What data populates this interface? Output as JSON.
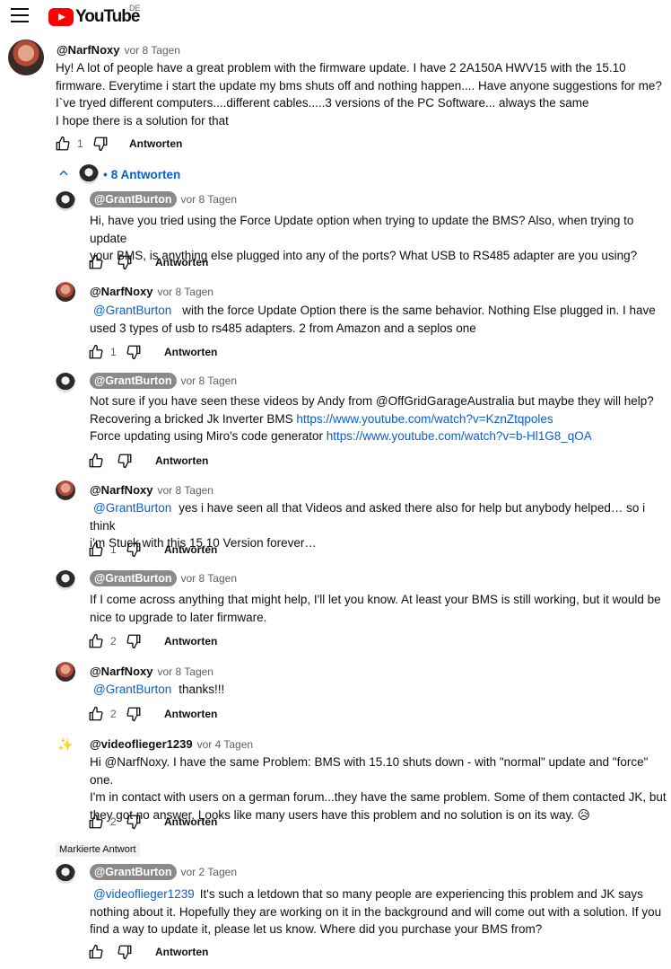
{
  "header": {
    "brand": "YouTube",
    "region": "DE"
  },
  "comment": {
    "author": "@NarfNoxy",
    "time": "vor 8 Tagen",
    "lines": [
      "Hy! A lot of people have a great problem with the firmware update. I have 2 2A150A HWV15 with the 15.10",
      "firmware. Everytime i start the update my bms shuts off and nothing happen.... Have anyone suggestions for me?",
      "I`ve tryed different computers....different cables.....3 versions of the PC Software... always the same",
      "I hope there is a solution for that"
    ],
    "likes": "1",
    "reply_label": "Antworten"
  },
  "replies_toggle": {
    "bullet": "•",
    "label": "8 Antworten"
  },
  "replies": [
    {
      "author": "@GrantBurton",
      "time": "vor 8 Tagen",
      "text1": "Hi, have you tried using the Force Update option when trying to update the BMS? Also, when trying to update",
      "text2": "your BMS, is anything else plugged into any of the ports? What USB to RS485 adapter are you using?",
      "likes": "",
      "reply_label": "Antworten"
    },
    {
      "author": "@NarfNoxy",
      "time": "vor 8 Tagen",
      "mention": "@GrantBurton",
      "text1": "with the force Update Option there is the same behavior. Nothing Else plugged in. I have",
      "text2": "used 3 types of usb to rs485 adapters. 2 from Amazon and a seplos one",
      "likes": "1",
      "reply_label": "Antworten"
    },
    {
      "author": "@GrantBurton",
      "time": "vor 8 Tagen",
      "text1": "Not sure if you have seen these videos by Andy from @OffGridGarageAustralia but maybe they will help?",
      "text2": "Recovering a bricked Jk Inverter BMS",
      "link2": "https://www.youtube.com/watch?v=KznZtqpoles",
      "text3": "Force updating using Miro's code generator",
      "link3": "https://www.youtube.com/watch?v=b-Hl1G8_qOA",
      "likes": "",
      "reply_label": "Antworten"
    },
    {
      "author": "@NarfNoxy",
      "time": "vor 8 Tagen",
      "mention": "@GrantBurton",
      "text1": "yes i have seen all that Videos and asked there also for help but anybody helped… so i think",
      "text2": "i’m Stuck with this 15.10 Version forever…",
      "likes": "1",
      "reply_label": "Antworten"
    },
    {
      "author": "@GrantBurton",
      "time": "vor 8 Tagen",
      "text1": "If I come across anything that might help, I'll let you know. At least your BMS is still working, but it would be",
      "text2": "nice to upgrade to later firmware.",
      "likes": "2",
      "reply_label": "Antworten"
    },
    {
      "author": "@NarfNoxy",
      "time": "vor 8 Tagen",
      "mention": "@GrantBurton",
      "text1": "thanks!!!",
      "likes": "2",
      "reply_label": "Antworten"
    },
    {
      "author": "@videoflieger1239",
      "time": "vor 4 Tagen",
      "text1": "Hi @NarfNoxy. I have the same Problem: BMS with 15.10 shuts down - with \"normal\" update and \"force\" one.",
      "text2": "I'm in contact with users on a german forum...they have the same problem. Some of them contacted JK, but",
      "text3": "they got no answer. Looks like many users have this problem and no solution is on its way. 😥",
      "likes": "2",
      "reply_label": "Antworten"
    },
    {
      "badge": "Markierte Antwort",
      "author": "@GrantBurton",
      "time": "vor 2 Tagen",
      "mention": "@videoflieger1239",
      "text1": "It's such a letdown that so many people are experiencing this problem and JK says",
      "text2": "nothing about it. Hopefully they are working on it in the background and will come out with a solution. If you",
      "text3": "find a way to update it, please let us know. Where did you purchase your BMS from?",
      "likes": "",
      "reply_label": "Antworten"
    }
  ]
}
